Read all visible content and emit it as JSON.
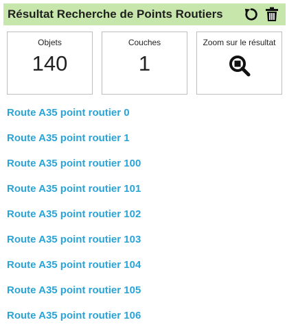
{
  "header": {
    "title": "Résultat Recherche de Points Routiers",
    "reset_icon": "reset-icon",
    "delete_icon": "trash-icon"
  },
  "cards": {
    "objects": {
      "label": "Objets",
      "value": "140"
    },
    "layers": {
      "label": "Couches",
      "value": "1"
    },
    "zoom": {
      "label": "Zoom sur le résultat",
      "icon": "zoom-to-result-icon"
    }
  },
  "results": [
    "Route A35 point routier 0",
    "Route A35 point routier 1",
    "Route A35 point routier 100",
    "Route A35 point routier 101",
    "Route A35 point routier 102",
    "Route A35 point routier 103",
    "Route A35 point routier 104",
    "Route A35 point routier 105",
    "Route A35 point routier 106"
  ],
  "colors": {
    "header_bg": "#c7e6ab",
    "link": "#2aa3d6"
  }
}
